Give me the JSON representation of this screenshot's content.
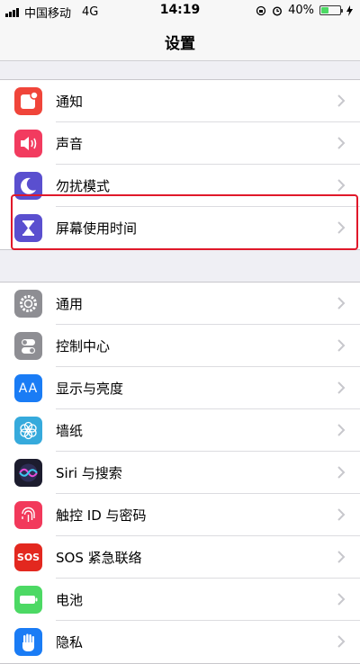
{
  "status_bar": {
    "carrier": "中国移动",
    "network": "4G",
    "time": "14:19",
    "battery": "40%",
    "battery_level": 0.4
  },
  "nav": {
    "title": "设置"
  },
  "group1": [
    {
      "label": "通知",
      "icon": "notifications-icon",
      "color": "#f0453a"
    },
    {
      "label": "声音",
      "icon": "sounds-icon",
      "color": "#f23b5f"
    },
    {
      "label": "勿扰模式",
      "icon": "moon-icon",
      "color": "#5a4fcf"
    },
    {
      "label": "屏幕使用时间",
      "icon": "hourglass-icon",
      "color": "#5a4fcf"
    }
  ],
  "group2": [
    {
      "label": "通用",
      "icon": "gear-icon",
      "color": "#8e8e93"
    },
    {
      "label": "控制中心",
      "icon": "toggle-icon",
      "color": "#8e8e93"
    },
    {
      "label": "显示与亮度",
      "icon": "display-aa-icon",
      "color": "#1a7cf5"
    },
    {
      "label": "墙纸",
      "icon": "flower-icon",
      "color": "#36aadc"
    },
    {
      "label": "Siri 与搜索",
      "icon": "siri-icon",
      "color": "#1c1c2e"
    },
    {
      "label": "触控 ID 与密码",
      "icon": "fingerprint-icon",
      "color": "#f2395b"
    },
    {
      "label": "SOS 紧急联络",
      "icon": "sos-icon",
      "color": "#e3281f"
    },
    {
      "label": "电池",
      "icon": "battery-icon",
      "color": "#4cd964"
    },
    {
      "label": "隐私",
      "icon": "hand-icon",
      "color": "#1a7cf5"
    }
  ],
  "icons": {
    "sos_text": "SOS",
    "display_text": "AA"
  },
  "colors": {
    "highlight": "#e0182a",
    "background": "#efeff4",
    "chevron": "#c7c7cc"
  }
}
